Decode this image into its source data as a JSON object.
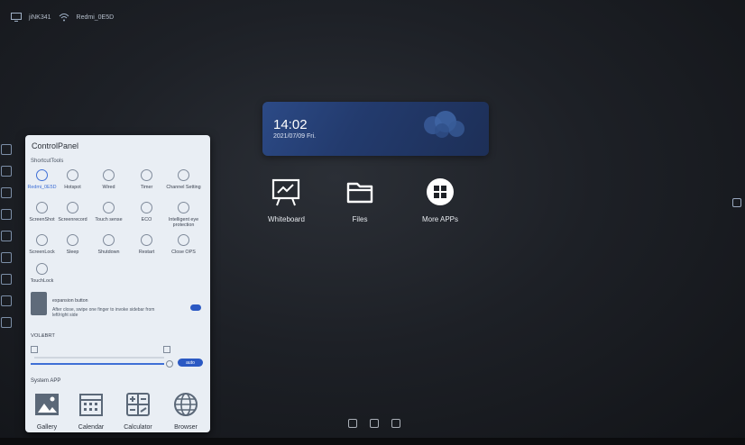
{
  "statusbar": {
    "display_label": "jiNK341",
    "wifi_label": "Redmi_0E5D"
  },
  "widget": {
    "time": "14:02",
    "date": "2021/07/09 Fri."
  },
  "home_apps": [
    {
      "label": "Whiteboard",
      "icon": "whiteboard-icon"
    },
    {
      "label": "Files",
      "icon": "folder-icon"
    },
    {
      "label": "More APPs",
      "icon": "apps-grid-icon"
    }
  ],
  "control_panel": {
    "title": "ControlPanel",
    "shortcut_title": "ShortcutTools",
    "tools_row1": [
      {
        "label": "Redmi_0E5D",
        "icon": "wifi-icon",
        "active": true
      },
      {
        "label": "Hotspot",
        "icon": "hotspot-icon"
      },
      {
        "label": "Wired",
        "icon": "wired-icon"
      },
      {
        "label": "Timer",
        "icon": "timer-icon"
      },
      {
        "label": "Channel Setting",
        "icon": "channel-icon"
      }
    ],
    "tools_row2": [
      {
        "label": "ScreenShot",
        "icon": "screenshot-icon"
      },
      {
        "label": "Screenrecord",
        "icon": "screenrecord-icon"
      },
      {
        "label": "Touch sense",
        "icon": "touch-icon"
      },
      {
        "label": "ECO",
        "icon": "eco-icon"
      },
      {
        "label": "Intelligent eye protection",
        "icon": "eye-icon"
      }
    ],
    "tools_row3": [
      {
        "label": "ScreenLock",
        "icon": "lock-icon"
      },
      {
        "label": "Sleep",
        "icon": "sleep-icon"
      },
      {
        "label": "Shutdown",
        "icon": "power-icon"
      },
      {
        "label": "Restart",
        "icon": "restart-icon"
      },
      {
        "label": "Close OPS",
        "icon": "ops-icon"
      }
    ],
    "tools_row4": [
      {
        "label": "TouchLock",
        "icon": "touchlock-icon"
      }
    ],
    "expansion": {
      "title": "expansion button",
      "desc": "After close, swipe one finger to invoke sidebar from left/right side"
    },
    "volume_label": "VOL&BRT",
    "auto_label": "auto",
    "system_app_title": "System APP",
    "system_apps": [
      {
        "label": "Gallery",
        "icon": "gallery-icon"
      },
      {
        "label": "Calendar",
        "icon": "calendar-icon"
      },
      {
        "label": "Calculator",
        "icon": "calculator-icon"
      },
      {
        "label": "Browser",
        "icon": "globe-icon"
      }
    ]
  },
  "colors": {
    "accent": "#3e6fd6",
    "widget_bg": "#233b6e",
    "panel_bg": "#e9eef4"
  }
}
